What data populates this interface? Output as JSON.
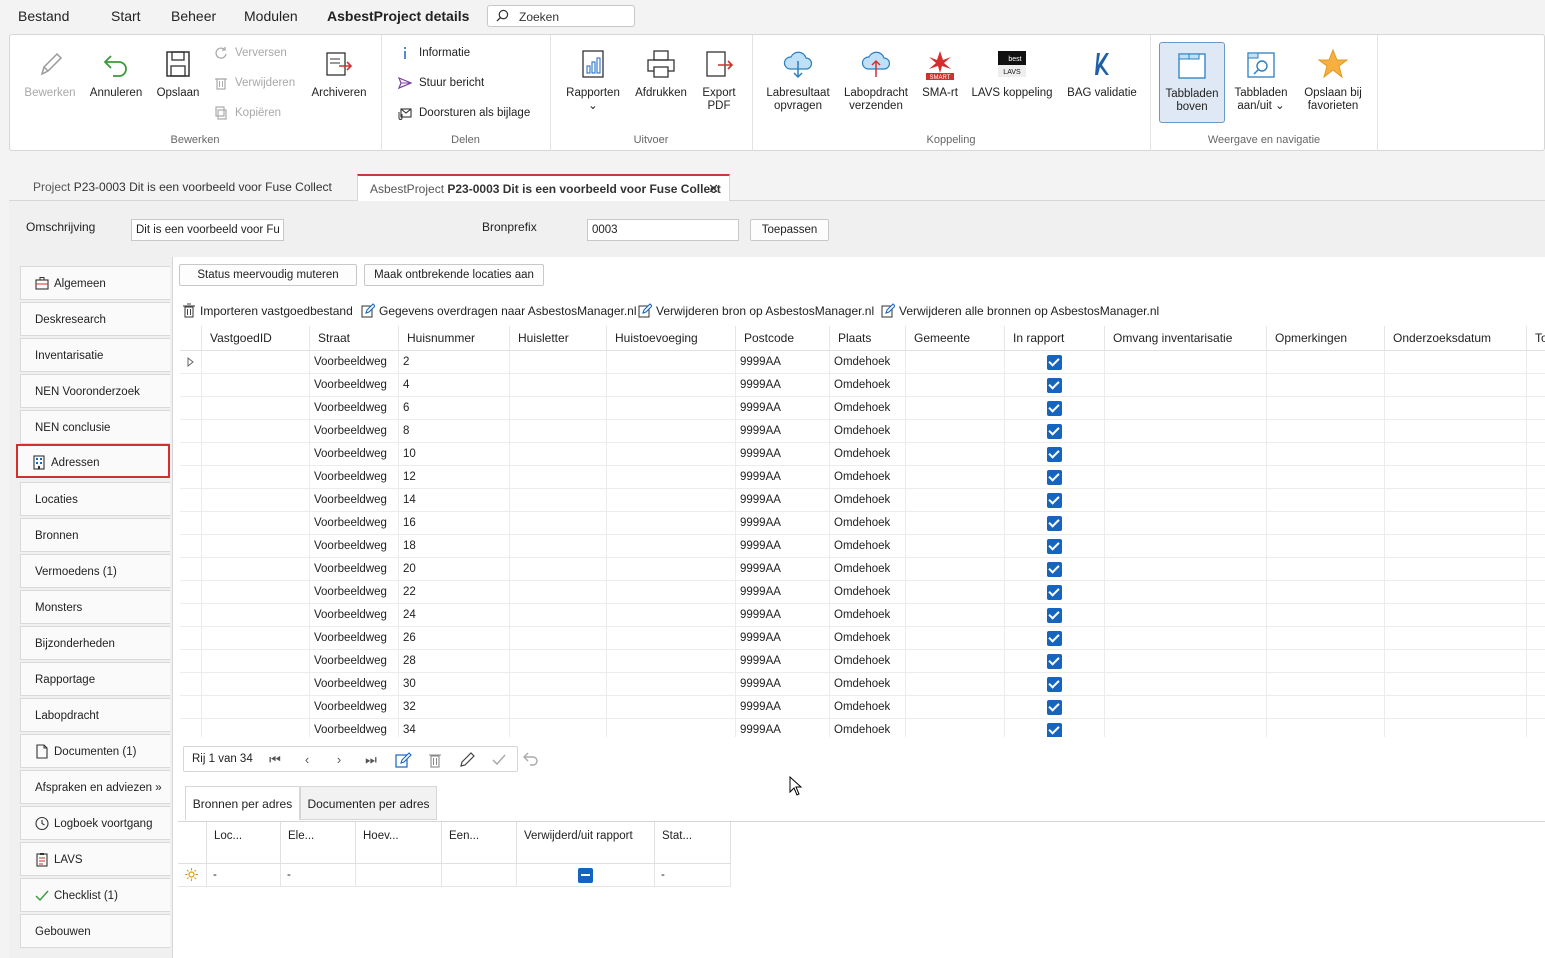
{
  "menu": {
    "bestand": "Bestand",
    "start": "Start",
    "beheer": "Beheer",
    "modulen": "Modulen",
    "active": "AsbestProject details",
    "search_placeholder": "Zoeken"
  },
  "ribbon": {
    "bewerken_group": {
      "label": "Bewerken",
      "bewerken": "Bewerken",
      "annuleren": "Annuleren",
      "opslaan": "Opslaan",
      "verversen": "Verversen",
      "verwijderen": "Verwijderen",
      "kopieren": "Kopiëren",
      "archiveren": "Archiveren"
    },
    "delen_group": {
      "label": "Delen",
      "informatie": "Informatie",
      "stuur_bericht": "Stuur bericht",
      "doorsturen": "Doorsturen als bijlage"
    },
    "uitvoer_group": {
      "label": "Uitvoer",
      "rapporten": "Rapporten",
      "afdrukken": "Afdrukken",
      "export_pdf_1": "Export",
      "export_pdf_2": "PDF"
    },
    "koppeling_group": {
      "label": "Koppeling",
      "labresultaat_1": "Labresultaat",
      "labresultaat_2": "opvragen",
      "labopdracht_1": "Labopdracht",
      "labopdracht_2": "verzenden",
      "sma_rt": "SMA-rt",
      "lavs_koppeling": "LAVS koppeling",
      "bag_validatie": "BAG validatie",
      "smart_logo": "SMART",
      "lavs_logo_top": "best",
      "lavs_logo_bottom": "LAVS"
    },
    "weergave_group": {
      "label": "Weergave en navigatie",
      "tabbladen_boven_1": "Tabbladen",
      "tabbladen_boven_2": "boven",
      "tabbladen_aanuit_1": "Tabbladen",
      "tabbladen_aanuit_2": "aan/uit",
      "favorieten_1": "Opslaan bij",
      "favorieten_2": "favorieten"
    }
  },
  "doc_tabs": [
    {
      "prefix": "Project ",
      "title": "P23-0003 Dit is een voorbeeld voor Fuse Collect"
    },
    {
      "prefix": "AsbestProject ",
      "title": "P23-0003 Dit is een voorbeeld voor Fuse Collect",
      "close": "✕"
    }
  ],
  "form": {
    "omschrijving_label": "Omschrijving",
    "omschrijving_value": "Dit is een voorbeeld voor Fu",
    "bronprefix_label": "Bronprefix",
    "bronprefix_value": "0003",
    "toepassen": "Toepassen"
  },
  "nav_items": [
    {
      "label": "Algemeen"
    },
    {
      "label": "Deskresearch"
    },
    {
      "label": "Inventarisatie"
    },
    {
      "label": "NEN Vooronderzoek"
    },
    {
      "label": "NEN conclusie"
    },
    {
      "label": "Adressen"
    },
    {
      "label": "Locaties"
    },
    {
      "label": "Bronnen"
    },
    {
      "label": "Vermoedens (1)"
    },
    {
      "label": "Monsters"
    },
    {
      "label": "Bijzonderheden"
    },
    {
      "label": "Rapportage"
    },
    {
      "label": "Labopdracht"
    },
    {
      "label": "Documenten (1)"
    },
    {
      "label": "Afspraken en adviezen »"
    },
    {
      "label": "Logboek voortgang"
    },
    {
      "label": "LAVS"
    },
    {
      "label": "Checklist (1)"
    },
    {
      "label": "Gebouwen"
    }
  ],
  "toolbar": {
    "status_mutate": "Status meervoudig muteren",
    "maak_locaties": "Maak ontbrekende locaties aan",
    "importeren": "Importeren vastgoedbestand",
    "gegevens_overdragen": "Gegevens overdragen naar AsbestosManager.nl",
    "verwijderen_bron": "Verwijderen bron op AsbestosManager.nl",
    "verwijderen_alle": "Verwijderen alle bronnen op AsbestosManager.nl"
  },
  "grid": {
    "columns": [
      "VastgoedID",
      "Straat",
      "Huisnummer",
      "Huisletter",
      "Huistoevoeging",
      "Postcode",
      "Plaats",
      "Gemeente",
      "In rapport",
      "Omvang inventarisatie",
      "Opmerkingen",
      "Onderzoeksdatum",
      "To"
    ],
    "rows": [
      {
        "straat": "Voorbeeldweg",
        "huisnummer": "2",
        "postcode": "9999AA",
        "plaats": "Omdehoek"
      },
      {
        "straat": "Voorbeeldweg",
        "huisnummer": "4",
        "postcode": "9999AA",
        "plaats": "Omdehoek"
      },
      {
        "straat": "Voorbeeldweg",
        "huisnummer": "6",
        "postcode": "9999AA",
        "plaats": "Omdehoek"
      },
      {
        "straat": "Voorbeeldweg",
        "huisnummer": "8",
        "postcode": "9999AA",
        "plaats": "Omdehoek"
      },
      {
        "straat": "Voorbeeldweg",
        "huisnummer": "10",
        "postcode": "9999AA",
        "plaats": "Omdehoek"
      },
      {
        "straat": "Voorbeeldweg",
        "huisnummer": "12",
        "postcode": "9999AA",
        "plaats": "Omdehoek"
      },
      {
        "straat": "Voorbeeldweg",
        "huisnummer": "14",
        "postcode": "9999AA",
        "plaats": "Omdehoek"
      },
      {
        "straat": "Voorbeeldweg",
        "huisnummer": "16",
        "postcode": "9999AA",
        "plaats": "Omdehoek"
      },
      {
        "straat": "Voorbeeldweg",
        "huisnummer": "18",
        "postcode": "9999AA",
        "plaats": "Omdehoek"
      },
      {
        "straat": "Voorbeeldweg",
        "huisnummer": "20",
        "postcode": "9999AA",
        "plaats": "Omdehoek"
      },
      {
        "straat": "Voorbeeldweg",
        "huisnummer": "22",
        "postcode": "9999AA",
        "plaats": "Omdehoek"
      },
      {
        "straat": "Voorbeeldweg",
        "huisnummer": "24",
        "postcode": "9999AA",
        "plaats": "Omdehoek"
      },
      {
        "straat": "Voorbeeldweg",
        "huisnummer": "26",
        "postcode": "9999AA",
        "plaats": "Omdehoek"
      },
      {
        "straat": "Voorbeeldweg",
        "huisnummer": "28",
        "postcode": "9999AA",
        "plaats": "Omdehoek"
      },
      {
        "straat": "Voorbeeldweg",
        "huisnummer": "30",
        "postcode": "9999AA",
        "plaats": "Omdehoek"
      },
      {
        "straat": "Voorbeeldweg",
        "huisnummer": "32",
        "postcode": "9999AA",
        "plaats": "Omdehoek"
      },
      {
        "straat": "Voorbeeldweg",
        "huisnummer": "34",
        "postcode": "9999AA",
        "plaats": "Omdehoek"
      }
    ]
  },
  "navbar": {
    "row_text": "Rij 1 van 34"
  },
  "sub_tabs": [
    "Bronnen per adres",
    "Documenten per adres"
  ],
  "subgrid": {
    "columns": [
      "Loc...",
      "Ele...",
      "Hoev...",
      "Een...",
      "Verwijderd/uit rapport",
      "Stat..."
    ],
    "row": [
      "-",
      "-",
      "",
      "",
      "",
      "-"
    ]
  },
  "colors": {
    "accent": "#1565c0",
    "selected_border": "#d32f2f"
  }
}
